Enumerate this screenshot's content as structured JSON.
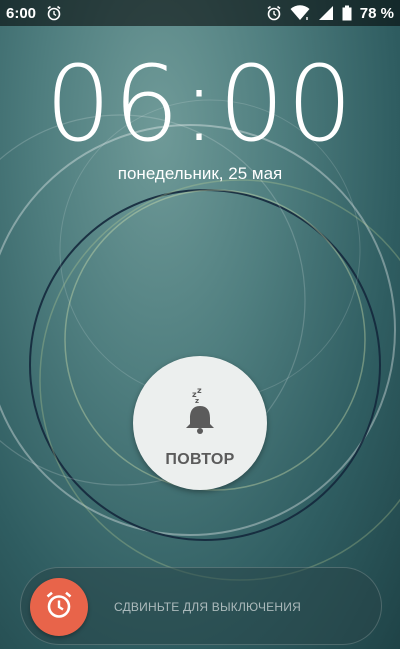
{
  "status_bar": {
    "time": "6:00",
    "alarm_icon": "alarm-clock-icon",
    "right_icons": [
      "alarm-clock-icon",
      "wifi-icon",
      "signal-icon",
      "battery-icon"
    ],
    "battery_percent": "78 %"
  },
  "lock": {
    "clock": "06:00",
    "date": "понедельник, 25 мая"
  },
  "alarm": {
    "snooze_label": "ПОВТОР",
    "snooze_icon": "snooze-bell-icon",
    "dismiss_hint": "СДВИНЬТЕ ДЛЯ ВЫКЛЮЧЕНИЯ",
    "dismiss_icon": "alarm-clock-icon"
  },
  "colors": {
    "background": "#3f6e70",
    "dismiss_accent": "#e8644a",
    "snooze_bg": "#ecefee"
  }
}
